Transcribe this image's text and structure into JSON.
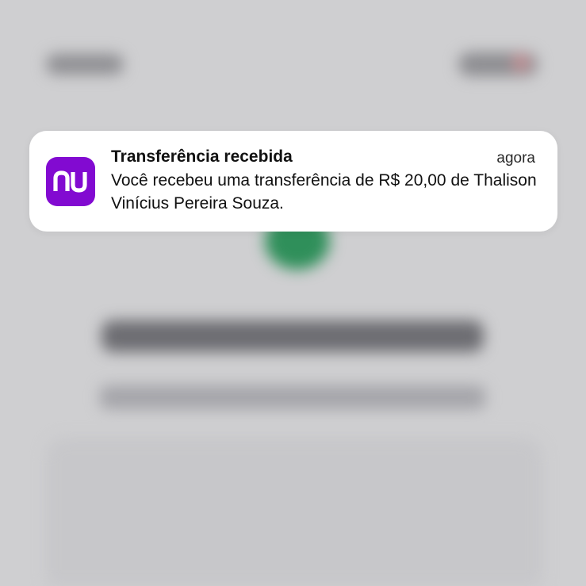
{
  "notification": {
    "app_icon": "nubank-nu-logo-icon",
    "title": "Transferência recebida",
    "time": "agora",
    "body": "Você recebeu uma transferência de R$ 20,00 de Thalison Vinícius Pereira Souza."
  },
  "colors": {
    "app_icon_background": "#820ad1",
    "banner_background": "#ffffff",
    "background_accent_green": "#2f8f5a"
  }
}
